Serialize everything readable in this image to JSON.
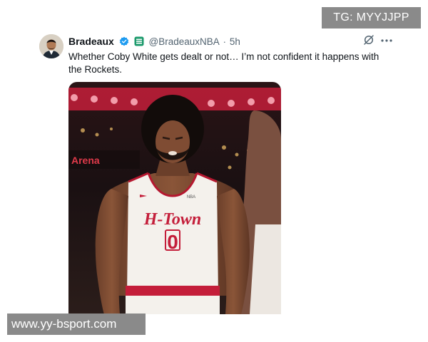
{
  "watermarks": {
    "top": "TG: MYYJJPP",
    "bottom": "www.yy-bsport.com"
  },
  "tweet": {
    "display_name": "Bradeaux",
    "handle": "@BradeauxNBA",
    "separator": "·",
    "time": "5h",
    "text": "Whether Coby White gets dealt or not… I’m not confident it happens with the Rockets.",
    "icons": {
      "verified": "verified-badge-icon",
      "affiliate": "affiliate-badge-icon",
      "grok": "grok-icon",
      "more": "more-options-icon"
    },
    "colors": {
      "verified": "#1d9bf0",
      "affiliate": "#1c9a6c",
      "secondary_text": "#536471"
    },
    "media": {
      "arena_sign": "Arena",
      "jersey_wordmark": "H-Town",
      "jersey_number": "0",
      "jersey_logo": "NBA"
    }
  }
}
